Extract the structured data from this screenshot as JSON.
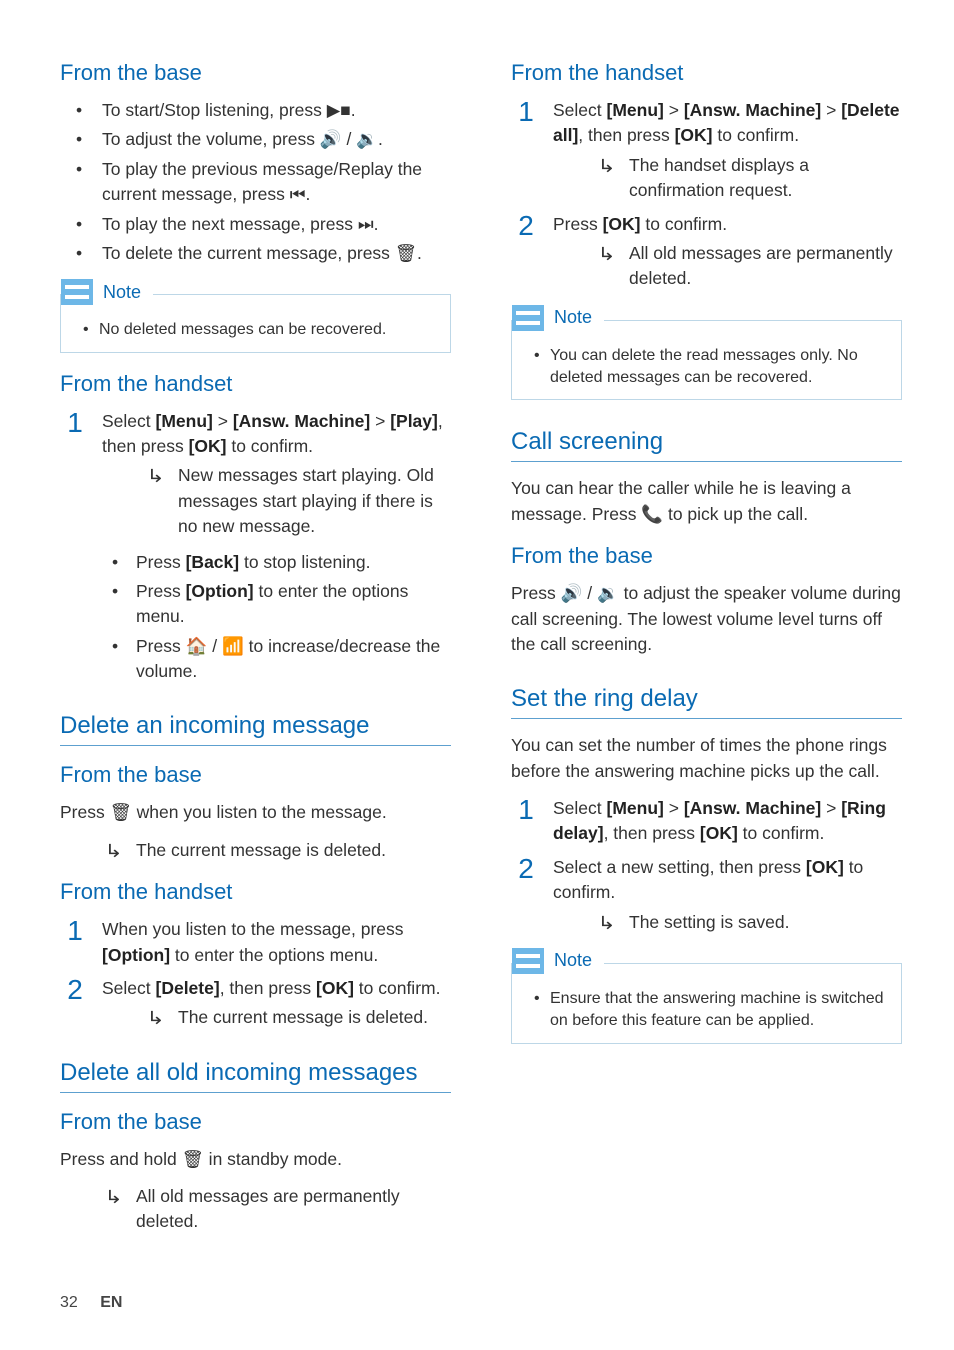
{
  "left": {
    "h_base1": "From the base",
    "base_items": [
      "To start/Stop listening, press ▶■.",
      "To adjust the volume, press 🔊 / 🔉.",
      "To play the previous message/Replay the current message, press ⏮.",
      "To play the next message, press ⏭.",
      "To delete the current message, press 🗑."
    ],
    "note1_label": "Note",
    "note1_text": "No deleted messages can be recovered.",
    "h_handset1": "From the handset",
    "step1_text_a": "Select ",
    "step1_menu": "[Menu]",
    "step1_gt1": " > ",
    "step1_am": "[Answ. Machine]",
    "step1_gt2": " > ",
    "step1_play": "[Play]",
    "step1_text_b": ", then press ",
    "step1_ok": "[OK]",
    "step1_text_c": " to confirm.",
    "step1_result": "New messages start playing. Old messages start playing if there is no new message.",
    "sub_items": [
      {
        "pre": "Press ",
        "b": "[Back]",
        "post": " to stop listening."
      },
      {
        "pre": "Press ",
        "b": "[Option]",
        "post": " to enter the options menu."
      },
      {
        "pre": "Press 🏠 / 📶 to increase/decrease the volume.",
        "b": "",
        "post": ""
      }
    ],
    "h_del_inc": "Delete an incoming message",
    "h_base2": "From the base",
    "base2_text": "Press 🗑 when you listen to the message.",
    "base2_result": "The current message is deleted.",
    "h_handset2": "From the handset",
    "hs2_step1_a": "When you listen to the message, press ",
    "hs2_step1_b": "[Option]",
    "hs2_step1_c": " to enter the options menu.",
    "hs2_step2_a": "Select ",
    "hs2_step2_b": "[Delete]",
    "hs2_step2_c": ", then press ",
    "hs2_step2_d": "[OK]",
    "hs2_step2_e": " to confirm.",
    "hs2_result": "The current message is deleted.",
    "h_del_all": "Delete all old incoming messages",
    "h_base3": "From the base",
    "base3_text": "Press and hold 🗑 in standby mode.",
    "base3_result": "All old messages are permanently deleted."
  },
  "right": {
    "h_handset3": "From the handset",
    "r_step1_a": "Select ",
    "r_step1_menu": "[Menu]",
    "r_step1_gt1": " > ",
    "r_step1_am": "[Answ. Machine]",
    "r_step1_gt2": " > ",
    "r_step1_del": "[Delete all]",
    "r_step1_b": ", then press ",
    "r_step1_ok": "[OK]",
    "r_step1_c": " to confirm.",
    "r_step1_result": "The handset displays a confirmation request.",
    "r_step2_a": "Press ",
    "r_step2_ok": "[OK]",
    "r_step2_b": " to confirm.",
    "r_step2_result": "All old messages are permanently deleted.",
    "note2_label": "Note",
    "note2_text": "You can delete the read messages only. No deleted messages can be recovered.",
    "h_call_scr": "Call screening",
    "call_scr_body": "You can hear the caller while he is leaving a message. Press 📞 to pick up the call.",
    "h_base4": "From the base",
    "base4_text": "Press 🔊 / 🔉 to adjust the speaker volume during call screening. The lowest volume level turns off the call screening.",
    "h_ring_delay": "Set the ring delay",
    "ring_body": "You can set the number of times the phone rings before the answering machine picks up the call.",
    "rd_step1_a": "Select ",
    "rd_step1_menu": "[Menu]",
    "rd_step1_gt1": " > ",
    "rd_step1_am": "[Answ. Machine]",
    "rd_step1_gt2": " > ",
    "rd_step1_rd": "[Ring delay]",
    "rd_step1_b": ", then press ",
    "rd_step1_ok": "[OK]",
    "rd_step1_c": " to confirm.",
    "rd_step2_a": "Select a new setting, then press ",
    "rd_step2_ok": "[OK]",
    "rd_step2_b": " to confirm.",
    "rd_step2_result": "The setting is saved.",
    "note3_label": "Note",
    "note3_text": "Ensure that the answering machine is switched on before this feature can be applied."
  },
  "footer": {
    "page": "32",
    "lang": "EN"
  }
}
